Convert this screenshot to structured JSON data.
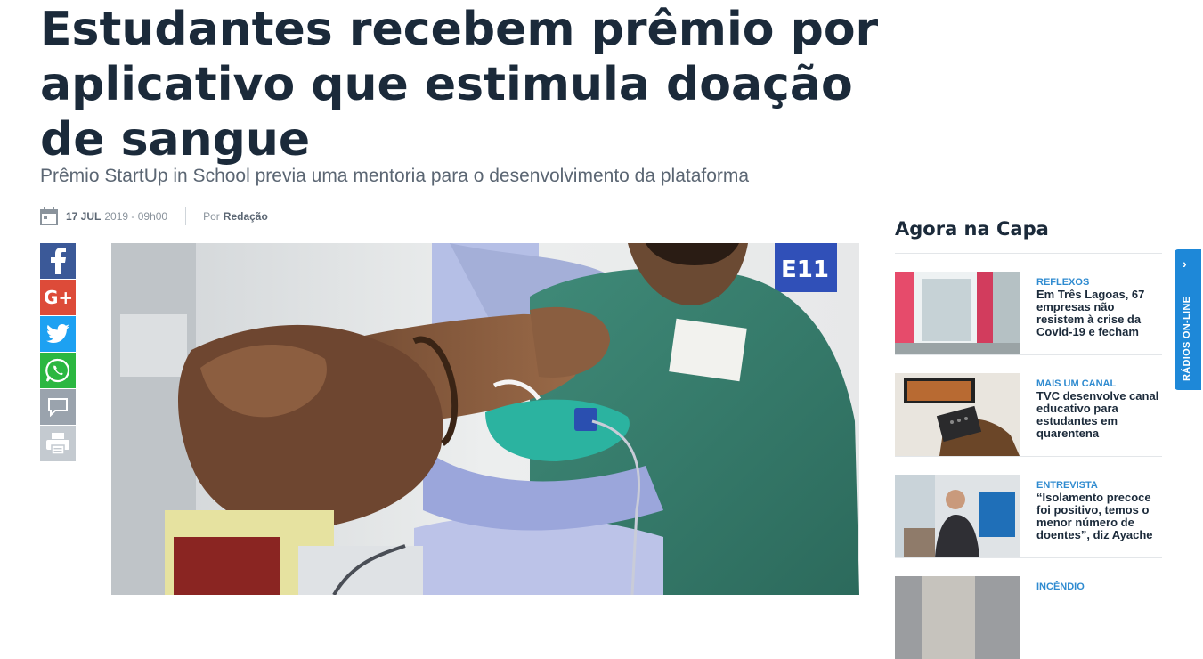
{
  "article": {
    "headline": "Estudantes recebem prêmio por aplicativo que estimula doação de sangue",
    "subtitle": "Prêmio StartUp in School previa uma mentoria para o desenvolvimento da plataforma",
    "date_bold": "17 JUL",
    "date_rest": "2019 - 09h00",
    "author_prefix": "Por",
    "author": "Redação",
    "photo_alt": "Homem doando sangue com braço apoiado na cadeira"
  },
  "share": {
    "items": [
      "facebook-icon",
      "google-plus-icon",
      "twitter-icon",
      "whatsapp-icon",
      "comment-icon",
      "print-icon"
    ]
  },
  "sidebar": {
    "title": "Agora na Capa",
    "items": [
      {
        "kicker": "REFLEXOS",
        "title": "Em Três Lagoas, 67 empresas não resistem à crise da Covid-19 e fecham"
      },
      {
        "kicker": "MAIS UM CANAL",
        "title": "TVC desenvolve canal educativo para estudantes em quarentena"
      },
      {
        "kicker": "ENTREVISTA",
        "title": "“Isolamento precoce foi positivo, temos o menor número de doentes”, diz Ayache"
      },
      {
        "kicker": "INCÊNDIO",
        "title": ""
      }
    ]
  },
  "radio": {
    "label": "RÁDIOS ON-LINE",
    "chevron": "›"
  },
  "colors": {
    "headline": "#1b2a3a",
    "accent": "#1e88d8",
    "kicker": "#2f8bd0"
  }
}
